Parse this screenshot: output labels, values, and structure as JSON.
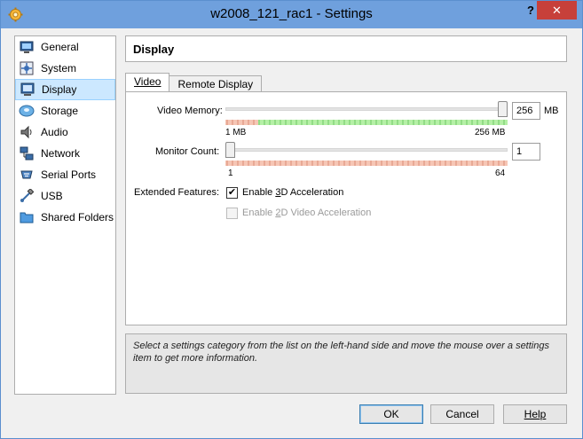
{
  "window": {
    "title": "w2008_121_rac1 - Settings",
    "help_glyph": "?",
    "close_glyph": "✕"
  },
  "sidebar": {
    "items": [
      {
        "label": "General",
        "icon": "general-icon"
      },
      {
        "label": "System",
        "icon": "system-icon"
      },
      {
        "label": "Display",
        "icon": "display-icon",
        "active": true
      },
      {
        "label": "Storage",
        "icon": "storage-icon"
      },
      {
        "label": "Audio",
        "icon": "audio-icon"
      },
      {
        "label": "Network",
        "icon": "network-icon"
      },
      {
        "label": "Serial Ports",
        "icon": "serial-ports-icon"
      },
      {
        "label": "USB",
        "icon": "usb-icon"
      },
      {
        "label": "Shared Folders",
        "icon": "shared-folders-icon"
      }
    ]
  },
  "main": {
    "header": "Display",
    "tabs": [
      {
        "label": "Video",
        "active": true
      },
      {
        "label": "Remote Display",
        "active": false
      }
    ],
    "video": {
      "memory_label": "Video Memory:",
      "memory_value": "256",
      "memory_unit": "MB",
      "memory_min_label": "1 MB",
      "memory_max_label": "256 MB",
      "memory_fraction": 1.0,
      "monitor_label": "Monitor Count:",
      "monitor_value": "1",
      "monitor_min_label": "1",
      "monitor_max_label": "64",
      "monitor_fraction": 0.0,
      "features_label": "Extended Features:",
      "enable_3d_label": "Enable 3D Acceleration",
      "enable_3d_checked": true,
      "enable_2d_label": "Enable 2D Video Acceleration",
      "enable_2d_checked": false
    }
  },
  "info_text": "Select a settings category from the list on the left-hand side and move the mouse over a settings item to get more information.",
  "buttons": {
    "ok": "OK",
    "cancel": "Cancel",
    "help": "Help"
  },
  "colors": {
    "green_range": "#b5f0a6",
    "red_range": "#f6c6b5",
    "accent": "#6fa0dd"
  }
}
